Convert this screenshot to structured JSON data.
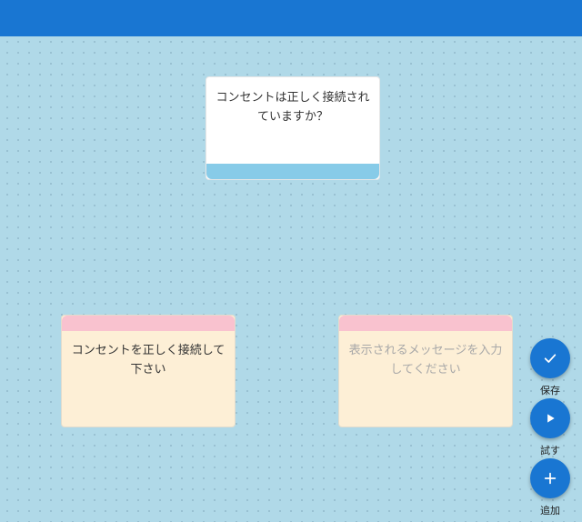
{
  "app": {
    "accent_color": "#1976d2",
    "canvas_color": "#b0d9e8"
  },
  "canvas": {
    "question_node": {
      "text": "コンセントは正しく接続されていますか？"
    },
    "message_nodes": [
      {
        "text": "コンセントを正しく接続して下さい",
        "is_placeholder": false
      },
      {
        "text": "表示されるメッセージを入力してください",
        "is_placeholder": true
      }
    ]
  },
  "actions": {
    "save": {
      "label": "保存",
      "icon": "check-icon"
    },
    "try": {
      "label": "試す",
      "icon": "play-icon"
    },
    "add": {
      "label": "追加",
      "icon": "plus-icon"
    }
  }
}
